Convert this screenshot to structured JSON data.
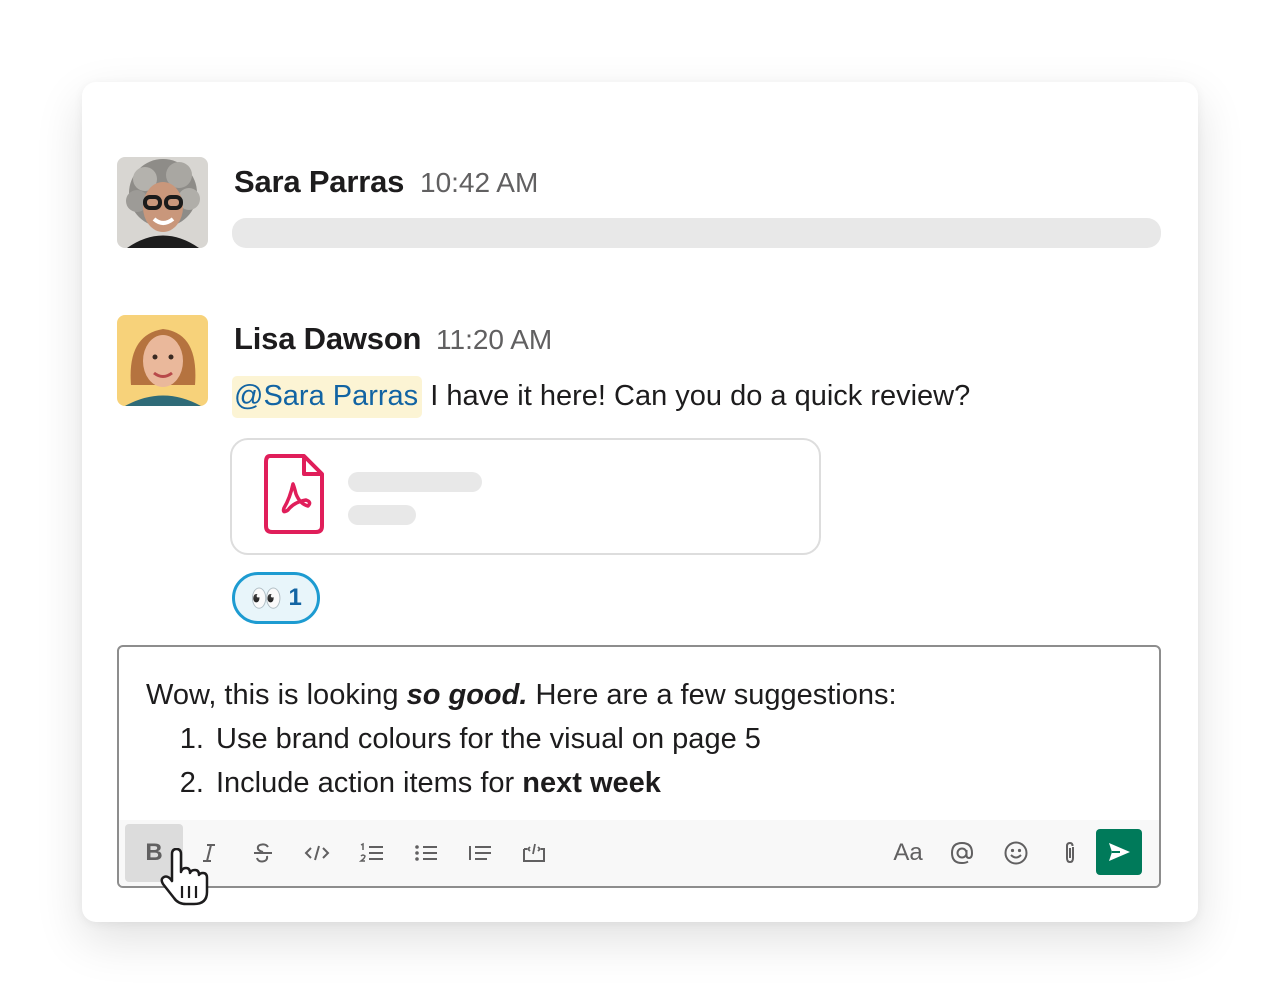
{
  "colors": {
    "mention_bg": "#fcf4d4",
    "mention_text": "#1264a3",
    "reaction_border": "#1d9bd1",
    "reaction_bg": "#e8f5fa",
    "send_button": "#007a5a",
    "pdf_icon": "#e01e5a"
  },
  "messages": [
    {
      "author": "Sara Parras",
      "time": "10:42 AM"
    },
    {
      "author": "Lisa Dawson",
      "time": "11:20 AM",
      "mention": "@Sara Parras",
      "text": " I have it here! Can you do a quick review?",
      "attachment_icon": "pdf-file-icon",
      "reaction": {
        "emoji": "👀",
        "count": "1"
      }
    }
  ],
  "composer": {
    "intro_before": "Wow, this is looking ",
    "intro_emphasis": "so good.",
    "intro_after": " Here are a few suggestions:",
    "list": [
      {
        "text": "Use brand colours for the visual on page 5",
        "bold": ""
      },
      {
        "text": "Include action items for ",
        "bold": "next week"
      }
    ],
    "toolbar": {
      "bold_label": "B",
      "icons": [
        "bold-icon",
        "italic-icon",
        "strikethrough-icon",
        "code-icon",
        "ordered-list-icon",
        "bulleted-list-icon",
        "blockquote-icon",
        "code-block-icon",
        "formatting-icon",
        "mention-icon",
        "emoji-icon",
        "attachment-icon",
        "send-icon"
      ],
      "format_label": "Aa"
    }
  }
}
